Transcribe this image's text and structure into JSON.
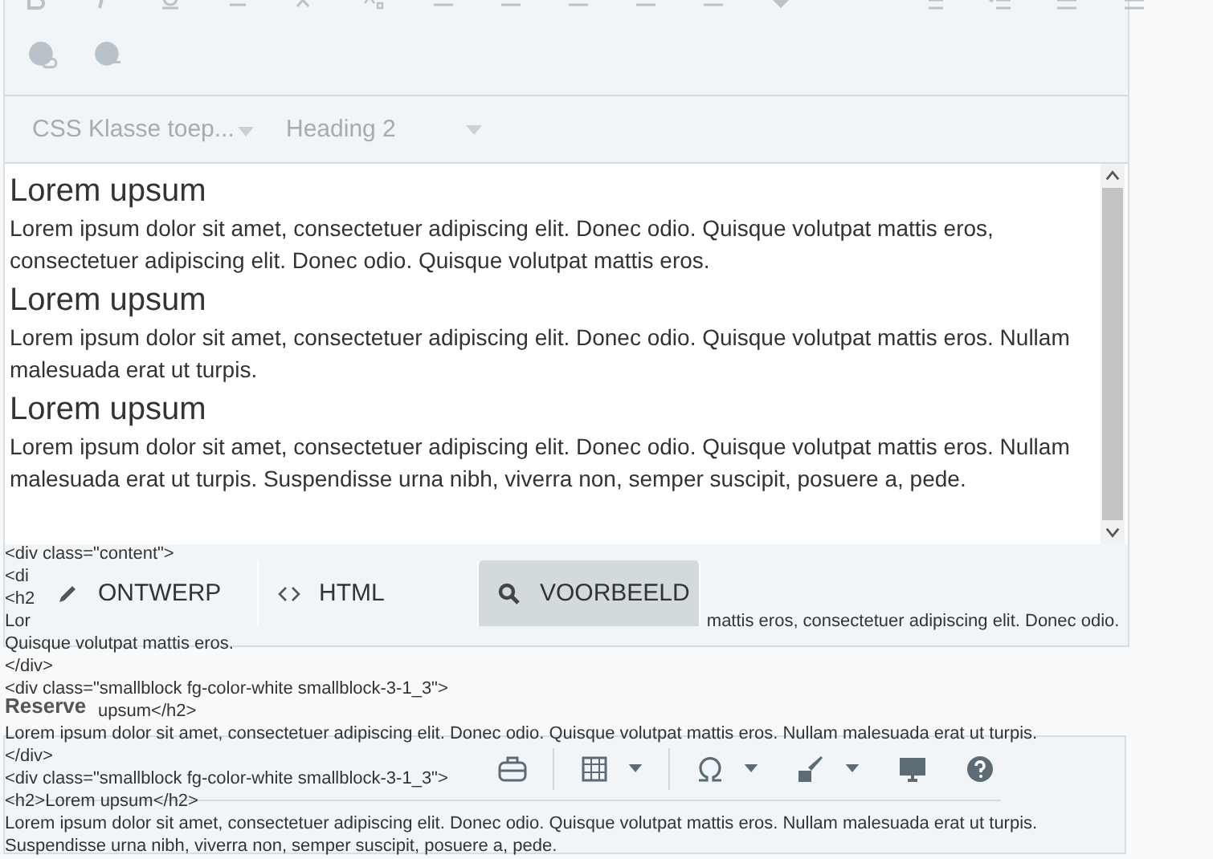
{
  "style_bar": {
    "class_select": {
      "placeholder": "CSS Klasse toep..."
    },
    "format_select": {
      "value": "Heading 2"
    }
  },
  "content": [
    {
      "kind": "heading",
      "text": "Lorem upsum"
    },
    {
      "kind": "paragraph",
      "text": "Lorem ipsum dolor sit amet, consectetuer adipiscing elit. Donec odio. Quisque volutpat mattis eros, consectetuer adipiscing elit. Donec odio. Quisque volutpat mattis eros."
    },
    {
      "kind": "heading",
      "text": "Lorem upsum"
    },
    {
      "kind": "paragraph",
      "text": "Lorem ipsum dolor sit amet, consectetuer adipiscing elit. Donec odio. Quisque volutpat mattis eros. Nullam malesuada erat ut turpis."
    },
    {
      "kind": "heading",
      "text": "Lorem upsum"
    },
    {
      "kind": "paragraph",
      "text": "Lorem ipsum dolor sit amet, consectetuer adipiscing elit. Donec odio. Quisque volutpat mattis eros. Nullam malesuada erat ut turpis. Suspendisse urna nibh, viverra non, semper suscipit, posuere a, pede."
    }
  ],
  "tabs": [
    {
      "label": "ONTWERP",
      "kind": "pencil",
      "selected": false
    },
    {
      "label": "HTML",
      "kind": "code",
      "selected": false
    },
    {
      "label": "VOORBEELD",
      "kind": "search",
      "selected": true
    }
  ],
  "code_lines": [
    {
      "text": "<div class=\"content\">"
    },
    {
      "text": "<di"
    },
    {
      "text": "<h2"
    },
    {
      "text": "Lor",
      "tail": "mattis eros, consectetuer adipiscing elit. Donec odio."
    },
    {
      "text": "Quisque volutpat mattis eros."
    },
    {
      "text": "</div>"
    },
    {
      "text": "<div class=\"smallblock fg-color-white smallblock-3-1_3\">"
    },
    {
      "kind": "after_label",
      "text": "upsum</h2>"
    },
    {
      "text": "Lorem ipsum dolor sit amet, consectetuer adipiscing elit. Donec odio. Quisque volutpat mattis eros. Nullam malesuada erat ut turpis."
    },
    {
      "text": "</div>"
    },
    {
      "text": "<div class=\"smallblock fg-color-white smallblock-3-1_3\">"
    },
    {
      "text": "<h2>Lorem upsum</h2>"
    },
    {
      "text": "Lorem ipsum dolor sit amet, consectetuer adipiscing elit. Donec odio. Quisque volutpat mattis eros. Nullam malesuada erat ut turpis."
    },
    {
      "text": "Suspendisse urna nibh, viverra non, semper suscipit, posuere a, pede."
    }
  ],
  "section_label": "Reserve"
}
